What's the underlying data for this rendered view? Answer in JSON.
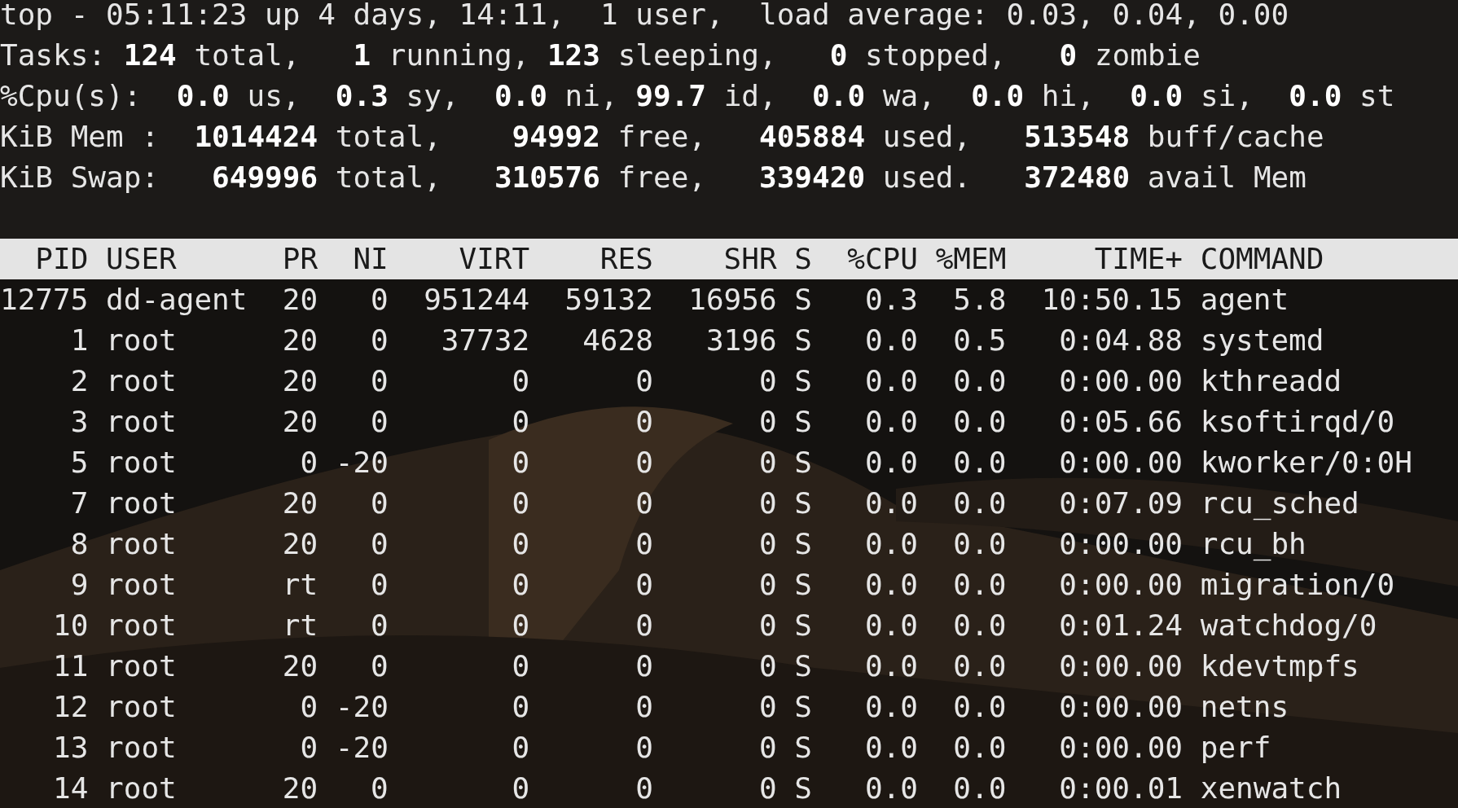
{
  "summary": [
    "top - 05:11:23 up 4 days, 14:11,  1 user,  load average: 0.03, 0.04, 0.00",
    "Tasks: **124** total,   **1** running, **123** sleeping,   **0** stopped,   **0** zombie",
    "%Cpu(s):  **0.0** us,  **0.3** sy,  **0.0** ni, **99.7** id,  **0.0** wa,  **0.0** hi,  **0.0** si,  **0.0** st",
    "KiB Mem :  **1014424** total,    **94992** free,   **405884** used,   **513548** buff/cache",
    "KiB Swap:   **649996** total,   **310576** free,   **339420** used.   **372480** avail Mem"
  ],
  "table": {
    "columns": [
      "PID",
      "USER",
      "PR",
      "NI",
      "VIRT",
      "RES",
      "SHR",
      "S",
      "%CPU",
      "%MEM",
      "TIME+",
      "COMMAND"
    ],
    "rows": [
      [
        "12775",
        "dd-agent",
        "20",
        "0",
        "951244",
        "59132",
        "16956",
        "S",
        "0.3",
        "5.8",
        "10:50.15",
        "agent"
      ],
      [
        "1",
        "root",
        "20",
        "0",
        "37732",
        "4628",
        "3196",
        "S",
        "0.0",
        "0.5",
        "0:04.88",
        "systemd"
      ],
      [
        "2",
        "root",
        "20",
        "0",
        "0",
        "0",
        "0",
        "S",
        "0.0",
        "0.0",
        "0:00.00",
        "kthreadd"
      ],
      [
        "3",
        "root",
        "20",
        "0",
        "0",
        "0",
        "0",
        "S",
        "0.0",
        "0.0",
        "0:05.66",
        "ksoftirqd/0"
      ],
      [
        "5",
        "root",
        "0",
        "-20",
        "0",
        "0",
        "0",
        "S",
        "0.0",
        "0.0",
        "0:00.00",
        "kworker/0:0H"
      ],
      [
        "7",
        "root",
        "20",
        "0",
        "0",
        "0",
        "0",
        "S",
        "0.0",
        "0.0",
        "0:07.09",
        "rcu_sched"
      ],
      [
        "8",
        "root",
        "20",
        "0",
        "0",
        "0",
        "0",
        "S",
        "0.0",
        "0.0",
        "0:00.00",
        "rcu_bh"
      ],
      [
        "9",
        "root",
        "rt",
        "0",
        "0",
        "0",
        "0",
        "S",
        "0.0",
        "0.0",
        "0:00.00",
        "migration/0"
      ],
      [
        "10",
        "root",
        "rt",
        "0",
        "0",
        "0",
        "0",
        "S",
        "0.0",
        "0.0",
        "0:01.24",
        "watchdog/0"
      ],
      [
        "11",
        "root",
        "20",
        "0",
        "0",
        "0",
        "0",
        "S",
        "0.0",
        "0.0",
        "0:00.00",
        "kdevtmpfs"
      ],
      [
        "12",
        "root",
        "0",
        "-20",
        "0",
        "0",
        "0",
        "S",
        "0.0",
        "0.0",
        "0:00.00",
        "netns"
      ],
      [
        "13",
        "root",
        "0",
        "-20",
        "0",
        "0",
        "0",
        "S",
        "0.0",
        "0.0",
        "0:00.00",
        "perf"
      ],
      [
        "14",
        "root",
        "20",
        "0",
        "0",
        "0",
        "0",
        "S",
        "0.0",
        "0.0",
        "0:00.01",
        "xenwatch"
      ]
    ]
  }
}
